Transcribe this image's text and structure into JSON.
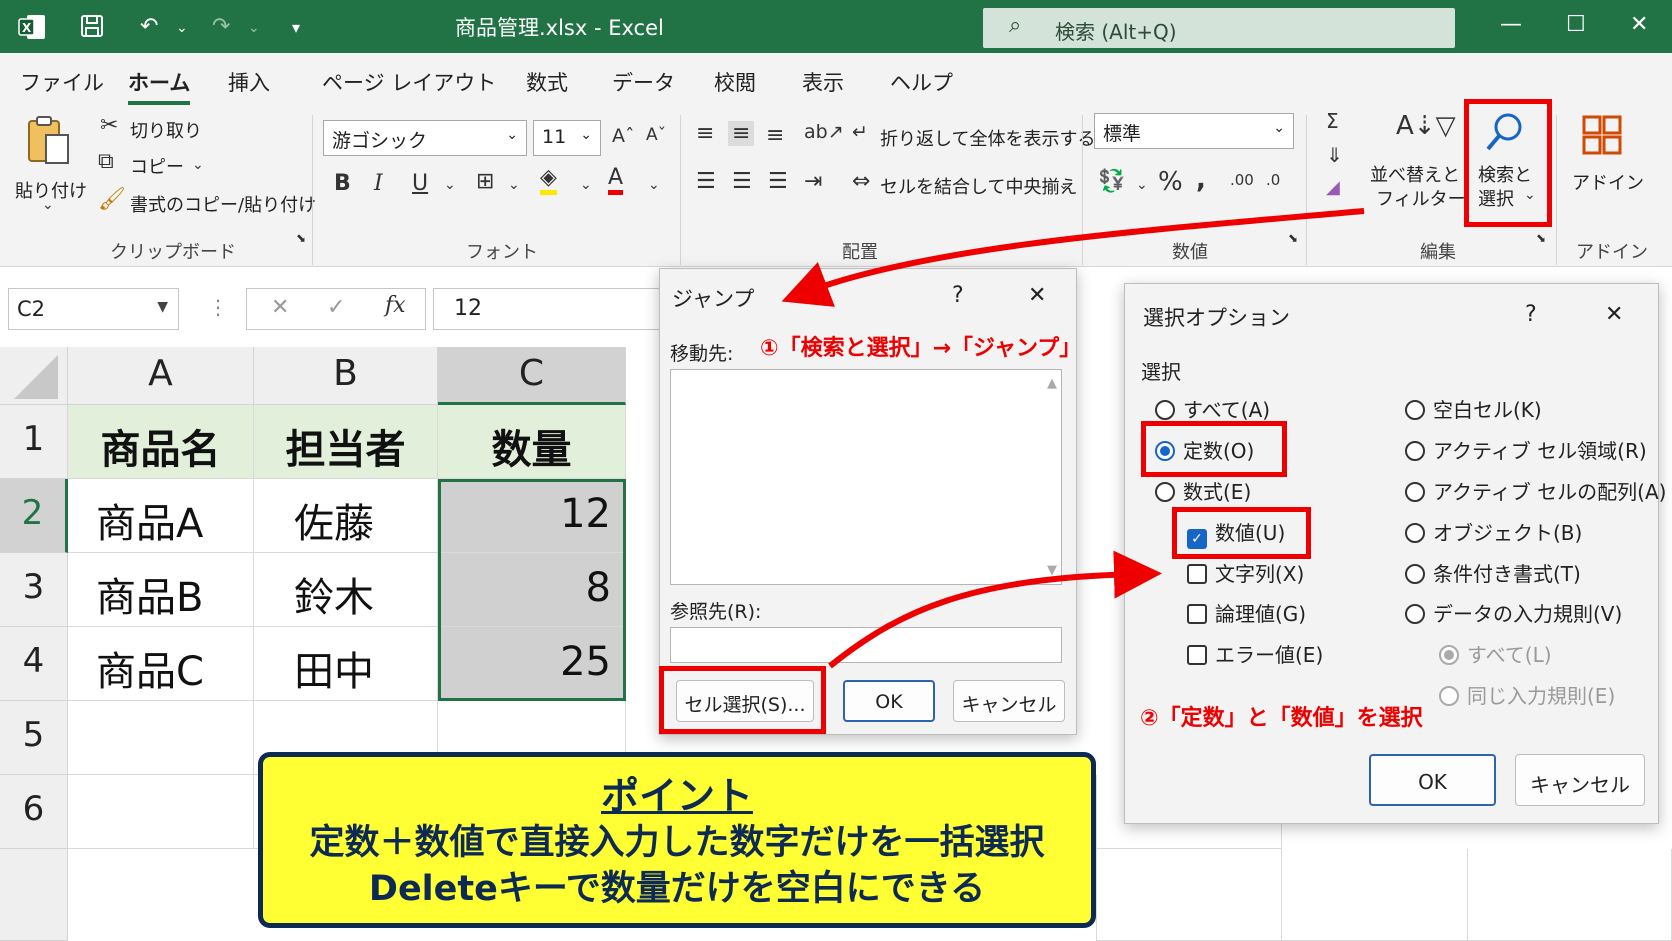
{
  "titlebar": {
    "doc_title": "商品管理.xlsx  -  Excel",
    "search_placeholder": "検索 (Alt+Q)"
  },
  "menu": [
    "ファイル",
    "ホーム",
    "挿入",
    "ページ レイアウト",
    "数式",
    "データ",
    "校閲",
    "表示",
    "ヘルプ"
  ],
  "ribbon": {
    "paste": "貼り付け",
    "cut": "切り取り",
    "copy": "コピー",
    "format_painter": "書式のコピー/貼り付け",
    "clipboard_label": "クリップボード",
    "font_name": "游ゴシック",
    "font_size": "11",
    "font_label": "フォント",
    "wrap_text": "折り返して全体を表示する",
    "merge_center": "セルを結合して中央揃え",
    "align_label": "配置",
    "number_format": "標準",
    "number_label": "数値",
    "sort_filter_1": "並べ替えと",
    "sort_filter_2": "フィルター",
    "find_select_1": "検索と",
    "find_select_2": "選択",
    "edit_label": "編集",
    "addin": "アドイン",
    "addin_label": "アドイン"
  },
  "formula_bar": {
    "name_box": "C2",
    "fx": "fx",
    "value": "12"
  },
  "sheet": {
    "columns": [
      "A",
      "B",
      "C"
    ],
    "rows": [
      "1",
      "2",
      "3",
      "4",
      "5",
      "6"
    ],
    "headers": [
      "商品名",
      "担当者",
      "数量"
    ],
    "data": [
      {
        "name": "商品A",
        "person": "佐藤",
        "qty": "12"
      },
      {
        "name": "商品B",
        "person": "鈴木",
        "qty": "8"
      },
      {
        "name": "商品C",
        "person": "田中",
        "qty": "25"
      }
    ]
  },
  "jump_dialog": {
    "title": "ジャンプ",
    "help": "?",
    "goto_label": "移動先:",
    "reference_label": "参照先(R):",
    "special_button": "セル選択(S)...",
    "ok": "OK",
    "cancel": "キャンセル"
  },
  "special_dialog": {
    "title": "選択オプション",
    "help": "?",
    "section": "選択",
    "left_options": [
      "すべて(A)",
      "定数(O)",
      "数式(E)"
    ],
    "sub_options": [
      "数値(U)",
      "文字列(X)",
      "論理値(G)",
      "エラー値(E)"
    ],
    "right_options": [
      "空白セル(K)",
      "アクティブ セル領域(R)",
      "アクティブ セルの配列(A)",
      "オブジェクト(B)",
      "条件付き書式(T)",
      "データの入力規則(V)"
    ],
    "right_sub_options": [
      "すべて(L)",
      "同じ入力規則(E)"
    ],
    "ok": "OK",
    "cancel": "キャンセル"
  },
  "annotations": {
    "step1": "①「検索と選択」→「ジャンプ」",
    "step2": "②「定数」と「数値」を選択"
  },
  "point": {
    "title": "ポイント",
    "line1": "定数＋数値で直接入力した数字だけを一括選択",
    "line2": "Deleteキーで数量だけを空白にできる"
  },
  "colors": {
    "excel_green": "#217346",
    "highlight_red": "#e00000",
    "point_yellow": "#ffff33",
    "point_navy": "#0d2a55"
  }
}
